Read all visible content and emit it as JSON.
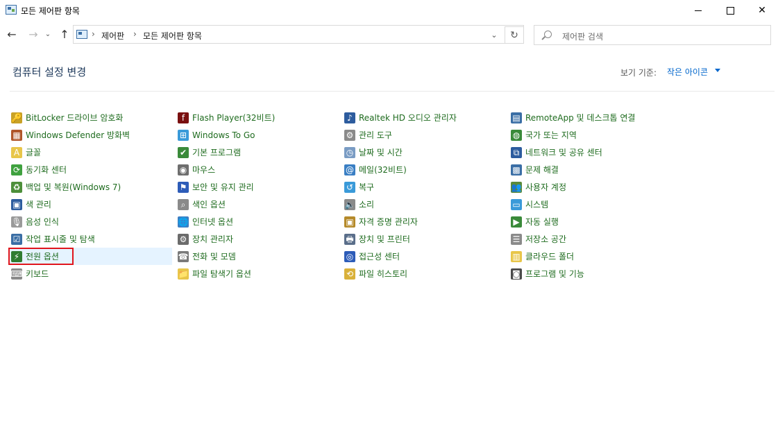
{
  "window": {
    "title": "모든 제어판 항목",
    "minimize": "—",
    "maximize": "☐",
    "close": "✕"
  },
  "nav": {
    "back_icon": "←",
    "forward_icon": "→",
    "recent_icon": "⌄",
    "up_icon": "↑",
    "breadcrumbs": [
      "제어판",
      "모든 제어판 항목"
    ],
    "separator": "›",
    "dropdown_icon": "⌄",
    "refresh_icon": "↻",
    "search_placeholder": "제어판 검색"
  },
  "header": {
    "title": "컴퓨터 설정 변경",
    "view_by_label": "보기 기준:",
    "view_by_value": "작은 아이콘"
  },
  "columns": [
    [
      {
        "label": "BitLocker 드라이브 암호화",
        "icon": "bitlocker-icon",
        "glyph": "🔑",
        "bg": "#c9a227"
      },
      {
        "label": "Windows Defender 방화벽",
        "icon": "firewall-icon",
        "glyph": "▦",
        "bg": "#b0562a"
      },
      {
        "label": "글꼴",
        "icon": "fonts-icon",
        "glyph": "A",
        "bg": "#e8c64a"
      },
      {
        "label": "동기화 센터",
        "icon": "sync-center-icon",
        "glyph": "⟳",
        "bg": "#3fa13f"
      },
      {
        "label": "백업 및 복원(Windows 7)",
        "icon": "backup-icon",
        "glyph": "♻",
        "bg": "#4d8f3a"
      },
      {
        "label": "색 관리",
        "icon": "color-management-icon",
        "glyph": "▣",
        "bg": "#2d5c9e"
      },
      {
        "label": "음성 인식",
        "icon": "microphone-icon",
        "glyph": "🎙",
        "bg": "#9a9a9a"
      },
      {
        "label": "작업 표시줄 및 탐색",
        "icon": "taskbar-icon",
        "glyph": "☑",
        "bg": "#3a6ea5"
      },
      {
        "label": "전원 옵션",
        "icon": "power-options-icon",
        "glyph": "⚡",
        "bg": "#2f7d32"
      },
      {
        "label": "키보드",
        "icon": "keyboard-icon",
        "glyph": "⌨",
        "bg": "#8a8a8a"
      }
    ],
    [
      {
        "label": "Flash Player(32비트)",
        "icon": "flash-player-icon",
        "glyph": "f",
        "bg": "#7a1010"
      },
      {
        "label": "Windows To Go",
        "icon": "windows-to-go-icon",
        "glyph": "⊞",
        "bg": "#3a9ad9"
      },
      {
        "label": "기본 프로그램",
        "icon": "default-programs-icon",
        "glyph": "✔",
        "bg": "#3a8a3a"
      },
      {
        "label": "마우스",
        "icon": "mouse-icon",
        "glyph": "◉",
        "bg": "#6e6e6e"
      },
      {
        "label": "보안 및 유지 관리",
        "icon": "security-maintenance-icon",
        "glyph": "⚑",
        "bg": "#2d5cb8"
      },
      {
        "label": "색인 옵션",
        "icon": "indexing-options-icon",
        "glyph": "⌕",
        "bg": "#8a8a8a"
      },
      {
        "label": "인터넷 옵션",
        "icon": "internet-options-icon",
        "glyph": "🌐",
        "bg": "#3a7fc4"
      },
      {
        "label": "장치 관리자",
        "icon": "device-manager-icon",
        "glyph": "⚙",
        "bg": "#6b6b6b"
      },
      {
        "label": "전화 및 모뎀",
        "icon": "phone-modem-icon",
        "glyph": "☎",
        "bg": "#7a7a7a"
      },
      {
        "label": "파일 탐색기 옵션",
        "icon": "file-explorer-options-icon",
        "glyph": "📁",
        "bg": "#e8c64a"
      }
    ],
    [
      {
        "label": "Realtek HD 오디오 관리자",
        "icon": "realtek-audio-icon",
        "glyph": "♪",
        "bg": "#2d5c9e"
      },
      {
        "label": "관리 도구",
        "icon": "admin-tools-icon",
        "glyph": "⚙",
        "bg": "#8a8a8a"
      },
      {
        "label": "날짜 및 시간",
        "icon": "date-time-icon",
        "glyph": "◷",
        "bg": "#7a9cc4"
      },
      {
        "label": "메일(32비트)",
        "icon": "mail-icon",
        "glyph": "@",
        "bg": "#3a7fc4"
      },
      {
        "label": "복구",
        "icon": "recovery-icon",
        "glyph": "↺",
        "bg": "#3a9ad9"
      },
      {
        "label": "소리",
        "icon": "sound-icon",
        "glyph": "🔈",
        "bg": "#8a8a8a"
      },
      {
        "label": "자격 증명 관리자",
        "icon": "credential-manager-icon",
        "glyph": "▣",
        "bg": "#b58a2a"
      },
      {
        "label": "장치 및 프린터",
        "icon": "devices-printers-icon",
        "glyph": "🖶",
        "bg": "#5a6e8a"
      },
      {
        "label": "접근성 센터",
        "icon": "ease-of-access-icon",
        "glyph": "◎",
        "bg": "#2d5cb8"
      },
      {
        "label": "파일 히스토리",
        "icon": "file-history-icon",
        "glyph": "⟲",
        "bg": "#d9b13a"
      }
    ],
    [
      {
        "label": "RemoteApp 및 데스크톱 연결",
        "icon": "remoteapp-icon",
        "glyph": "▤",
        "bg": "#3a6ea5"
      },
      {
        "label": "국가 또는 지역",
        "icon": "region-icon",
        "glyph": "◍",
        "bg": "#3a8a3a"
      },
      {
        "label": "네트워크 및 공유 센터",
        "icon": "network-sharing-icon",
        "glyph": "⧉",
        "bg": "#2d5c9e"
      },
      {
        "label": "문제 해결",
        "icon": "troubleshooting-icon",
        "glyph": "▩",
        "bg": "#3a6ea5"
      },
      {
        "label": "사용자 계정",
        "icon": "user-accounts-icon",
        "glyph": "👥",
        "bg": "#5a8a3a"
      },
      {
        "label": "시스템",
        "icon": "system-icon",
        "glyph": "▭",
        "bg": "#3a9ad9"
      },
      {
        "label": "자동 실행",
        "icon": "autoplay-icon",
        "glyph": "▶",
        "bg": "#3a8a3a"
      },
      {
        "label": "저장소 공간",
        "icon": "storage-spaces-icon",
        "glyph": "☰",
        "bg": "#8a8a8a"
      },
      {
        "label": "클라우드 폴더",
        "icon": "work-folders-icon",
        "glyph": "▥",
        "bg": "#e8c64a"
      },
      {
        "label": "프로그램 및 기능",
        "icon": "programs-features-icon",
        "glyph": "◙",
        "bg": "#4a4a4a"
      }
    ]
  ]
}
